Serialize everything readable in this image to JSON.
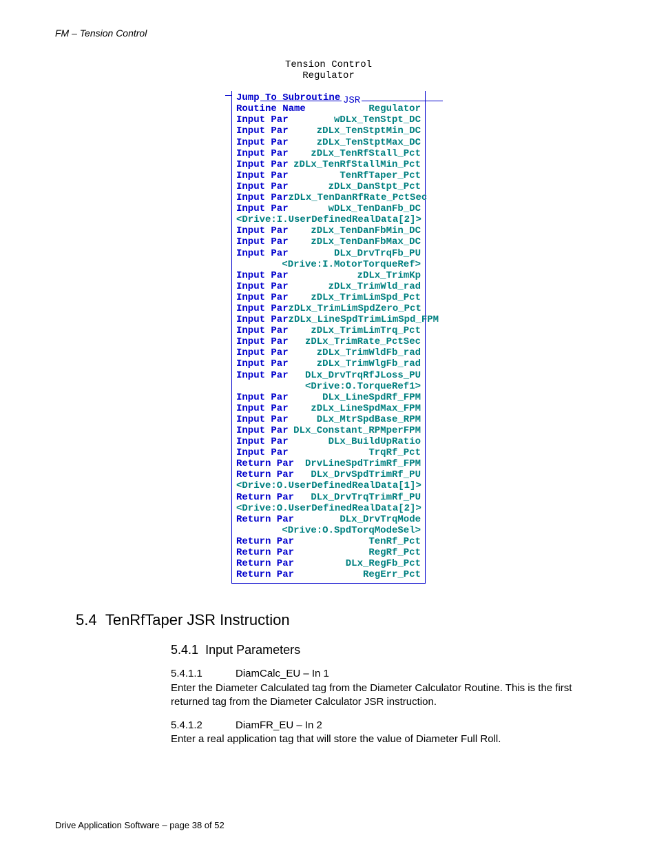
{
  "header": "FM – Tension Control",
  "diagram": {
    "title1": "Tension Control",
    "title2": "Regulator",
    "jsr": "JSR",
    "rows": [
      {
        "type": "pair",
        "label": "Jump To Subroutine",
        "value": ""
      },
      {
        "type": "pair",
        "label": "Routine Name",
        "value": "Regulator"
      },
      {
        "type": "pair",
        "label": "Input Par",
        "value": "wDLx_TenStpt_DC"
      },
      {
        "type": "pair",
        "label": "Input Par",
        "value": "zDLx_TenStptMin_DC"
      },
      {
        "type": "pair",
        "label": "Input Par",
        "value": "zDLx_TenStptMax_DC"
      },
      {
        "type": "pair",
        "label": "Input Par",
        "value": "zDLx_TenRfStall_Pct"
      },
      {
        "type": "pair",
        "label": "Input Par",
        "value": "zDLx_TenRfStallMin_Pct"
      },
      {
        "type": "pair",
        "label": "Input Par",
        "value": "TenRfTaper_Pct"
      },
      {
        "type": "pair",
        "label": "Input Par",
        "value": "zDLx_DanStpt_Pct"
      },
      {
        "type": "pair",
        "label": "Input Par",
        "value": "zDLx_TenDanRfRate_PctSec"
      },
      {
        "type": "pair",
        "label": "Input Par",
        "value": "wDLx_TenDanFb_DC"
      },
      {
        "type": "sub",
        "value": "<Drive:I.UserDefinedRealData[2]>"
      },
      {
        "type": "pair",
        "label": "Input Par",
        "value": "zDLx_TenDanFbMin_DC"
      },
      {
        "type": "pair",
        "label": "Input Par",
        "value": "zDLx_TenDanFbMax_DC"
      },
      {
        "type": "pair",
        "label": "Input Par",
        "value": "DLx_DrvTrqFb_PU"
      },
      {
        "type": "sub",
        "value": "<Drive:I.MotorTorqueRef>"
      },
      {
        "type": "pair",
        "label": "Input Par",
        "value": "zDLx_TrimKp"
      },
      {
        "type": "pair",
        "label": "Input Par",
        "value": "zDLx_TrimWld_rad"
      },
      {
        "type": "pair",
        "label": "Input Par",
        "value": "zDLx_TrimLimSpd_Pct"
      },
      {
        "type": "pair",
        "label": "Input Par",
        "value": "zDLx_TrimLimSpdZero_Pct"
      },
      {
        "type": "pair",
        "label": "Input Par",
        "value": "zDLx_LineSpdTrimLimSpd_FPM"
      },
      {
        "type": "pair",
        "label": "Input Par",
        "value": "zDLx_TrimLimTrq_Pct"
      },
      {
        "type": "pair",
        "label": "Input Par",
        "value": "zDLx_TrimRate_PctSec"
      },
      {
        "type": "pair",
        "label": "Input Par",
        "value": "zDLx_TrimWldFb_rad"
      },
      {
        "type": "pair",
        "label": "Input Par",
        "value": "zDLx_TrimWlgFb_rad"
      },
      {
        "type": "pair",
        "label": "Input Par",
        "value": "DLx_DrvTrqRfJLoss_PU"
      },
      {
        "type": "sub",
        "value": "<Drive:O.TorqueRef1>"
      },
      {
        "type": "pair",
        "label": "Input Par",
        "value": "DLx_LineSpdRf_FPM"
      },
      {
        "type": "pair",
        "label": "Input Par",
        "value": "zDLx_LineSpdMax_FPM"
      },
      {
        "type": "pair",
        "label": "Input Par",
        "value": "DLx_MtrSpdBase_RPM"
      },
      {
        "type": "pair",
        "label": "Input Par",
        "value": "DLx_Constant_RPMperFPM"
      },
      {
        "type": "pair",
        "label": "Input Par",
        "value": "DLx_BuildUpRatio"
      },
      {
        "type": "pair",
        "label": "Input Par",
        "value": "TrqRf_Pct"
      },
      {
        "type": "pair",
        "label": "Return Par",
        "value": "DrvLineSpdTrimRf_FPM"
      },
      {
        "type": "pair",
        "label": "Return Par",
        "value": "DLx_DrvSpdTrimRf_PU"
      },
      {
        "type": "sub",
        "value": "<Drive:O.UserDefinedRealData[1]>"
      },
      {
        "type": "pair",
        "label": "Return Par",
        "value": "DLx_DrvTrqTrimRf_PU"
      },
      {
        "type": "sub",
        "value": "<Drive:O.UserDefinedRealData[2]>"
      },
      {
        "type": "pair",
        "label": "Return Par",
        "value": "DLx_DrvTrqMode"
      },
      {
        "type": "sub",
        "value": "<Drive:O.SpdTorqModeSel>"
      },
      {
        "type": "pair",
        "label": "Return Par",
        "value": "TenRf_Pct"
      },
      {
        "type": "pair",
        "label": "Return Par",
        "value": "RegRf_Pct"
      },
      {
        "type": "pair",
        "label": "Return Par",
        "value": "DLx_RegFb_Pct"
      },
      {
        "type": "pair",
        "label": "Return Par",
        "value": "RegErr_Pct"
      }
    ]
  },
  "section": {
    "num": "5.4",
    "title": "TenRfTaper JSR Instruction"
  },
  "subsection": {
    "num": "5.4.1",
    "title": "Input Parameters"
  },
  "params": [
    {
      "num": "5.4.1.1",
      "name": "DiamCalc_EU – In 1",
      "text": "Enter the Diameter Calculated tag from the Diameter Calculator Routine.  This is the first returned tag from the Diameter Calculator JSR instruction."
    },
    {
      "num": "5.4.1.2",
      "name": "DiamFR_EU – In 2",
      "text": "Enter a real application tag that will store the value of Diameter Full Roll."
    }
  ],
  "footer": "Drive Application Software – page 38 of 52"
}
